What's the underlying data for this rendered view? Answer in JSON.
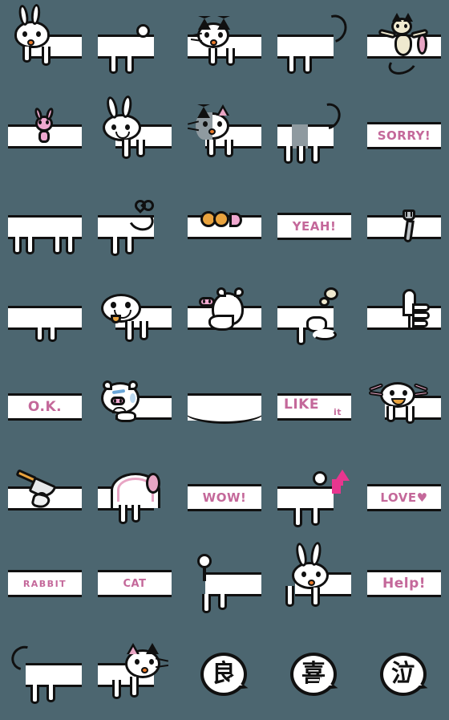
{
  "page": {
    "title": "Emoji Sticker Grid",
    "background_color": "#4c6670",
    "accent_pink": "#c4689a",
    "ink_black": "#101010",
    "sticker_white": "#ffffff",
    "columns": 5,
    "rows": 8,
    "total_stickers": 40
  },
  "stickers": [
    {
      "id": 1,
      "row": 1,
      "col": 1,
      "kind": "art",
      "name": "rabbit-peeking-front",
      "label": ""
    },
    {
      "id": 2,
      "row": 1,
      "col": 2,
      "kind": "art",
      "name": "dog-rear-with-tail",
      "label": ""
    },
    {
      "id": 3,
      "row": 1,
      "col": 3,
      "kind": "art",
      "name": "cat-face-whiskers",
      "label": ""
    },
    {
      "id": 4,
      "row": 1,
      "col": 4,
      "kind": "art",
      "name": "cat-rear-long-tail",
      "label": ""
    },
    {
      "id": 5,
      "row": 1,
      "col": 5,
      "kind": "art",
      "name": "cream-cat-stretching",
      "label": ""
    },
    {
      "id": 6,
      "row": 2,
      "col": 1,
      "kind": "art",
      "name": "pink-rabbit-small",
      "label": ""
    },
    {
      "id": 7,
      "row": 2,
      "col": 2,
      "kind": "art",
      "name": "rabbit-lying-down",
      "label": ""
    },
    {
      "id": 8,
      "row": 2,
      "col": 3,
      "kind": "art",
      "name": "gray-cat-face",
      "label": ""
    },
    {
      "id": 9,
      "row": 2,
      "col": 4,
      "kind": "art",
      "name": "cow-rear-curly-tail",
      "label": ""
    },
    {
      "id": 10,
      "row": 2,
      "col": 5,
      "kind": "text",
      "name": "sorry-text",
      "label": "SORRY!",
      "size": "t-md"
    },
    {
      "id": 11,
      "row": 3,
      "col": 1,
      "kind": "art",
      "name": "four-legs-standing",
      "label": ""
    },
    {
      "id": 12,
      "row": 3,
      "col": 2,
      "kind": "art",
      "name": "rear-heart-tail",
      "label": ""
    },
    {
      "id": 13,
      "row": 3,
      "col": 3,
      "kind": "art",
      "name": "dango-food-skewer",
      "label": ""
    },
    {
      "id": 14,
      "row": 3,
      "col": 4,
      "kind": "text",
      "name": "yeah-text",
      "label": "YEAH!",
      "size": "t-md"
    },
    {
      "id": 15,
      "row": 3,
      "col": 5,
      "kind": "art",
      "name": "fork-utensil",
      "label": ""
    },
    {
      "id": 16,
      "row": 4,
      "col": 1,
      "kind": "art",
      "name": "two-legs-short",
      "label": ""
    },
    {
      "id": 17,
      "row": 4,
      "col": 2,
      "kind": "art",
      "name": "dog-face-smiling",
      "label": ""
    },
    {
      "id": 18,
      "row": 4,
      "col": 3,
      "kind": "art",
      "name": "pig-lying-down",
      "label": ""
    },
    {
      "id": 19,
      "row": 4,
      "col": 4,
      "kind": "art",
      "name": "rear-farting-puff",
      "label": ""
    },
    {
      "id": 20,
      "row": 4,
      "col": 5,
      "kind": "art",
      "name": "thumbs-up-hand",
      "label": ""
    },
    {
      "id": 21,
      "row": 5,
      "col": 1,
      "kind": "text",
      "name": "ok-text",
      "label": "O.K.",
      "size": "t-lg"
    },
    {
      "id": 22,
      "row": 5,
      "col": 2,
      "kind": "art",
      "name": "pig-crying-sad",
      "label": ""
    },
    {
      "id": 23,
      "row": 5,
      "col": 3,
      "kind": "art",
      "name": "blank-curved-band",
      "label": ""
    },
    {
      "id": 24,
      "row": 5,
      "col": 4,
      "kind": "text",
      "name": "like-it-text",
      "label": "LIKE",
      "label2": "it",
      "size": "t-like"
    },
    {
      "id": 25,
      "row": 5,
      "col": 5,
      "kind": "art",
      "name": "axolotl-creature",
      "label": ""
    },
    {
      "id": 26,
      "row": 6,
      "col": 1,
      "kind": "art",
      "name": "knife-cutting-hand",
      "label": ""
    },
    {
      "id": 27,
      "row": 6,
      "col": 2,
      "kind": "art",
      "name": "creature-pink-tail",
      "label": ""
    },
    {
      "id": 28,
      "row": 6,
      "col": 3,
      "kind": "text",
      "name": "wow-text",
      "label": "WOW!",
      "size": "t-md"
    },
    {
      "id": 29,
      "row": 6,
      "col": 4,
      "kind": "art",
      "name": "dog-with-pink-arrow",
      "label": ""
    },
    {
      "id": 30,
      "row": 6,
      "col": 5,
      "kind": "text",
      "name": "love-text",
      "label": "LOVE♥",
      "size": "t-md"
    },
    {
      "id": 31,
      "row": 7,
      "col": 1,
      "kind": "text",
      "name": "rabbit-text",
      "label": "RABBIT",
      "size": "t-xs"
    },
    {
      "id": 32,
      "row": 7,
      "col": 2,
      "kind": "text",
      "name": "cat-text",
      "label": "CAT",
      "size": "t-sm"
    },
    {
      "id": 33,
      "row": 7,
      "col": 3,
      "kind": "art",
      "name": "dog-rear-round-tail",
      "label": ""
    },
    {
      "id": 34,
      "row": 7,
      "col": 4,
      "kind": "art",
      "name": "rabbit-waving",
      "label": ""
    },
    {
      "id": 35,
      "row": 7,
      "col": 5,
      "kind": "text",
      "name": "help-text",
      "label": "Help!",
      "size": "t-lg"
    },
    {
      "id": 36,
      "row": 8,
      "col": 1,
      "kind": "art",
      "name": "cat-rear-curly-tail",
      "label": ""
    },
    {
      "id": 37,
      "row": 8,
      "col": 2,
      "kind": "art",
      "name": "cat-face-side",
      "label": ""
    },
    {
      "id": 38,
      "row": 8,
      "col": 3,
      "kind": "kanji",
      "name": "kanji-good-bubble",
      "label": "良"
    },
    {
      "id": 39,
      "row": 8,
      "col": 4,
      "kind": "kanji",
      "name": "kanji-joy-bubble",
      "label": "喜"
    },
    {
      "id": 40,
      "row": 8,
      "col": 5,
      "kind": "kanji",
      "name": "kanji-cry-bubble",
      "label": "泣"
    }
  ]
}
